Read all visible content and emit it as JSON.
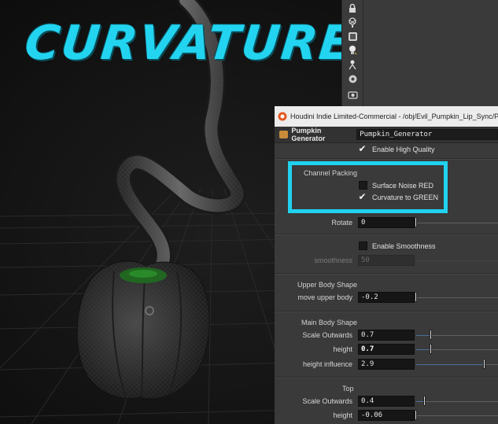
{
  "overlay": {
    "title": "CURVATURE",
    "title_color": "#22d4f0",
    "highlight_color": "#20d2ef"
  },
  "toolbar": {
    "tools": [
      "lock-icon",
      "ghost-icon",
      "display-options-icon",
      "lightbulb-icon",
      "point-icon",
      "render-icon",
      "snapshot-icon"
    ]
  },
  "window": {
    "title": "Houdini Indie Limited-Commercial - /obj/Evil_Pumpkin_Lip_Sync/P"
  },
  "node": {
    "type_label": "Pumpkin Generator",
    "name": "Pumpkin_Generator",
    "icon_color": "#c98b3a"
  },
  "params": {
    "enable_high_quality": {
      "label": "Enable High Quality",
      "checked": true
    },
    "channel_packing": {
      "title": "Channel Packing",
      "surface_noise_red": {
        "label": "Surface Noise RED",
        "checked": false
      },
      "curvature_to_green": {
        "label": "Curvature to GREEN",
        "checked": true
      }
    },
    "rotate": {
      "label": "Rotate",
      "value": "0"
    },
    "enable_smoothness": {
      "label": "Enable Smoothness",
      "checked": false
    },
    "smoothness": {
      "label": "smoothness",
      "value": "50"
    },
    "upper_body_shape": {
      "title": "Upper Body Shape",
      "move_upper_body": {
        "label": "move upper body",
        "value": "-0.2"
      }
    },
    "main_body_shape": {
      "title": "Main Body Shape",
      "scale_outwards": {
        "label": "Scale Outwards",
        "value": "0.7"
      },
      "height": {
        "label": "height",
        "value": "0.7"
      },
      "height_influence": {
        "label": "height influence",
        "value": "2.9"
      }
    },
    "top": {
      "title": "Top",
      "scale_outwards": {
        "label": "Scale Outwards",
        "value": "0.4"
      },
      "height": {
        "label": "height",
        "value": "-0.06"
      }
    }
  }
}
